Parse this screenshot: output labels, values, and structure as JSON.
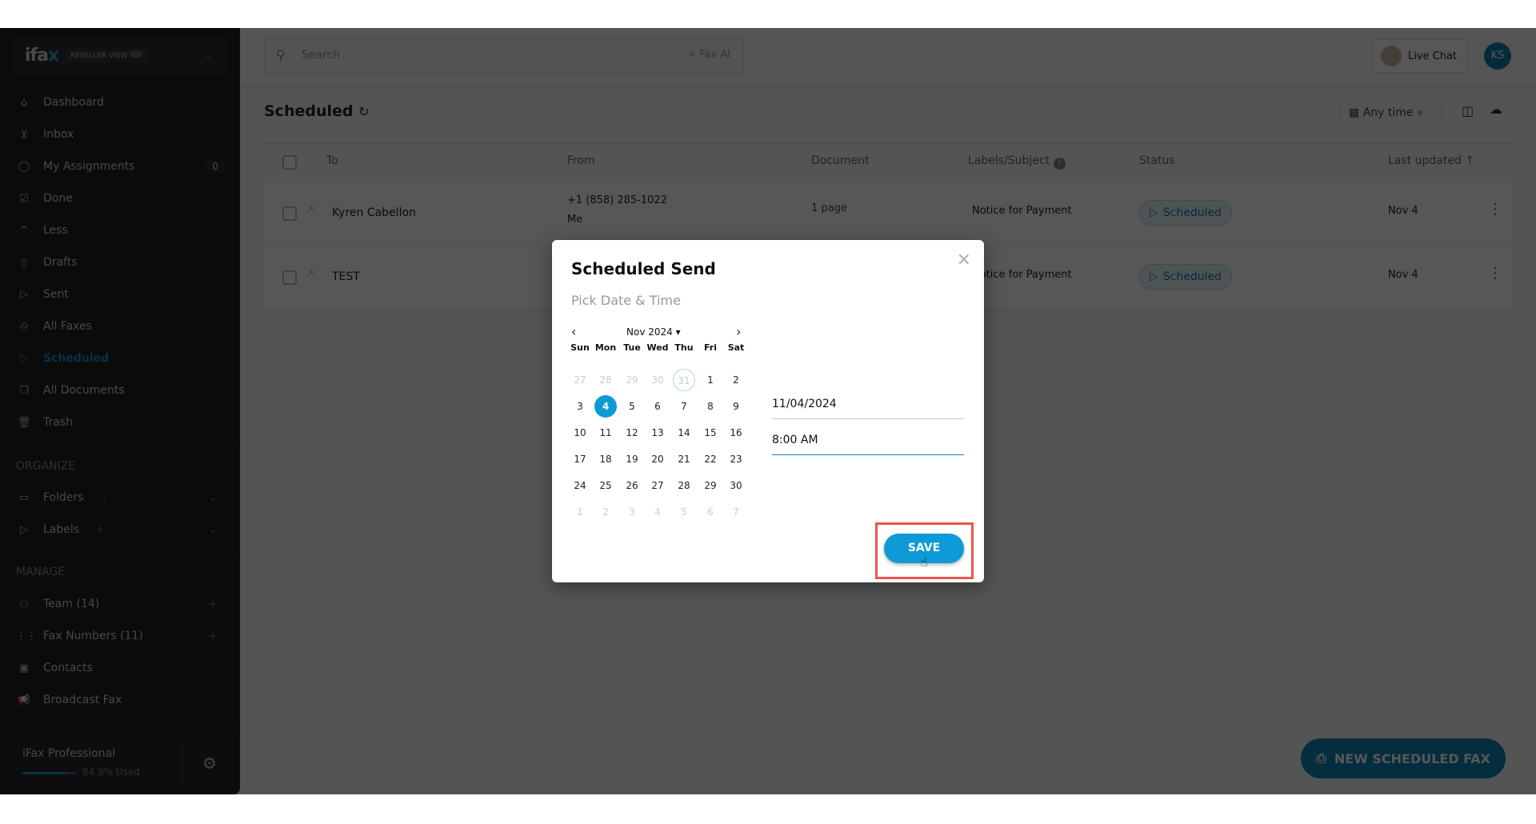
{
  "sidebar": {
    "logo": "ifax",
    "reseller": "RESELLER VIEW",
    "items": [
      {
        "label": "Dashboard",
        "icon": "home-icon",
        "glyph": "⌂"
      },
      {
        "label": "Inbox",
        "icon": "inbox-icon",
        "glyph": "⊻"
      },
      {
        "label": "My Assignments",
        "icon": "ks-badge-icon",
        "glyph": "◯",
        "count": "0"
      },
      {
        "label": "Done",
        "icon": "done-icon",
        "glyph": "☑"
      },
      {
        "label": "Less",
        "icon": "chevron-up-icon",
        "glyph": "^"
      },
      {
        "label": "Drafts",
        "icon": "draft-icon",
        "glyph": "▯"
      },
      {
        "label": "Sent",
        "icon": "send-icon",
        "glyph": "▷"
      },
      {
        "label": "All Faxes",
        "icon": "printer-icon",
        "glyph": "⎙"
      },
      {
        "label": "Scheduled",
        "icon": "scheduled-icon",
        "glyph": "▷",
        "active": true
      },
      {
        "label": "All Documents",
        "icon": "documents-icon",
        "glyph": "❐"
      },
      {
        "label": "Trash",
        "icon": "trash-icon",
        "glyph": "🗑"
      }
    ],
    "organize": "ORGANIZE",
    "organize_items": [
      {
        "label": "Folders",
        "icon": "folder-icon",
        "glyph": "▭"
      },
      {
        "label": "Labels",
        "icon": "label-icon",
        "glyph": "▷"
      }
    ],
    "manage": "MANAGE",
    "manage_items": [
      {
        "label": "Team (14)",
        "icon": "team-icon",
        "glyph": "⚇"
      },
      {
        "label": "Fax Numbers (11)",
        "icon": "dialpad-icon",
        "glyph": "⋮⋮"
      },
      {
        "label": "Contacts",
        "icon": "contacts-icon",
        "glyph": "▣"
      },
      {
        "label": "Broadcast Fax",
        "icon": "megaphone-icon",
        "glyph": "📢"
      }
    ],
    "plan": "iFax Professional",
    "usage": "84.9% Used",
    "usage_pct": 84.9
  },
  "topbar": {
    "search_placeholder": "Search",
    "fax_ai": "Fax AI",
    "live_chat": "Live Chat",
    "avatar": "KS"
  },
  "page": {
    "title": "Scheduled",
    "time_filter": "Any time"
  },
  "table": {
    "columns": [
      "To",
      "From",
      "Document",
      "Labels/Subject",
      "Status",
      "Last updated"
    ],
    "rows": [
      {
        "to": "Kyren Cabellon",
        "from": "+1 (858) 285-1022",
        "from_sub": "Me",
        "document": "1 page",
        "subject": "Notice for Payment",
        "status": "Scheduled",
        "updated": "Nov 4"
      },
      {
        "to": "TEST",
        "from": "",
        "from_sub": "",
        "document": "",
        "subject": "Notice for Payment",
        "status": "Scheduled",
        "updated": "Nov 4"
      }
    ]
  },
  "fab": "NEW SCHEDULED FAX",
  "modal": {
    "title": "Scheduled Send",
    "subtitle": "Pick Date & Time",
    "month": "Nov 2024",
    "weekdays": [
      "Sun",
      "Mon",
      "Tue",
      "Wed",
      "Thu",
      "Fri",
      "Sat"
    ],
    "weeks": [
      [
        "27",
        "28",
        "29",
        "30",
        "31",
        "1",
        "2"
      ],
      [
        "3",
        "4",
        "5",
        "6",
        "7",
        "8",
        "9"
      ],
      [
        "10",
        "11",
        "12",
        "13",
        "14",
        "15",
        "16"
      ],
      [
        "17",
        "18",
        "19",
        "20",
        "21",
        "22",
        "23"
      ],
      [
        "24",
        "25",
        "26",
        "27",
        "28",
        "29",
        "30"
      ],
      [
        "1",
        "2",
        "3",
        "4",
        "5",
        "6",
        "7"
      ]
    ],
    "selected": "4",
    "date": "11/04/2024",
    "time": "8:00 AM",
    "save": "SAVE"
  },
  "colors": {
    "accent": "#0d9ad6",
    "highlight": "#e8574c"
  }
}
